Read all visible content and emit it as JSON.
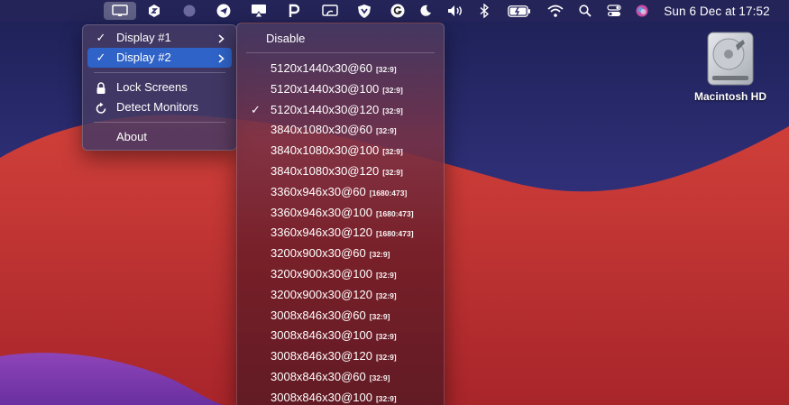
{
  "menubar": {
    "icons": [
      "display-icon",
      "hexagon-app-icon",
      "circle-app-icon",
      "telegram-icon",
      "airplay-icon",
      "parking-icon",
      "screen-mirror-icon",
      "shield-icon",
      "grammarly-icon",
      "moon-icon",
      "volume-icon",
      "bluetooth-icon",
      "battery-icon",
      "wifi-icon",
      "search-icon",
      "control-center-icon",
      "siri-icon"
    ],
    "clock": "Sun 6 Dec at  17:52"
  },
  "desktop": {
    "drive_label": "Macintosh HD"
  },
  "main_menu": {
    "items": [
      {
        "label": "Display #1",
        "checked": true,
        "submenu": true
      },
      {
        "label": "Display #2",
        "checked": true,
        "submenu": true,
        "highlighted": true
      },
      {
        "label": "Lock Screens",
        "icon": "lock-icon"
      },
      {
        "label": "Detect Monitors",
        "icon": "refresh-icon"
      },
      {
        "label": "About"
      }
    ],
    "check_glyph": "✓",
    "chevron_glyph": ">"
  },
  "sub_menu": {
    "disable_label": "Disable",
    "resolutions": [
      {
        "res": "5120x1440x30@60",
        "ratio": "[32:9]",
        "checked": false
      },
      {
        "res": "5120x1440x30@100",
        "ratio": "[32:9]",
        "checked": false
      },
      {
        "res": "5120x1440x30@120",
        "ratio": "[32:9]",
        "checked": true
      },
      {
        "res": "3840x1080x30@60",
        "ratio": "[32:9]",
        "checked": false
      },
      {
        "res": "3840x1080x30@100",
        "ratio": "[32:9]",
        "checked": false
      },
      {
        "res": "3840x1080x30@120",
        "ratio": "[32:9]",
        "checked": false
      },
      {
        "res": "3360x946x30@60",
        "ratio": "[1680:473]",
        "checked": false
      },
      {
        "res": "3360x946x30@100",
        "ratio": "[1680:473]",
        "checked": false
      },
      {
        "res": "3360x946x30@120",
        "ratio": "[1680:473]",
        "checked": false
      },
      {
        "res": "3200x900x30@60",
        "ratio": "[32:9]",
        "checked": false
      },
      {
        "res": "3200x900x30@100",
        "ratio": "[32:9]",
        "checked": false
      },
      {
        "res": "3200x900x30@120",
        "ratio": "[32:9]",
        "checked": false
      },
      {
        "res": "3008x846x30@60",
        "ratio": "[32:9]",
        "checked": false
      },
      {
        "res": "3008x846x30@100",
        "ratio": "[32:9]",
        "checked": false
      },
      {
        "res": "3008x846x30@120",
        "ratio": "[32:9]",
        "checked": false
      },
      {
        "res": "3008x846x30@60",
        "ratio": "[32:9]",
        "checked": false
      },
      {
        "res": "3008x846x30@100",
        "ratio": "[32:9]",
        "checked": false
      }
    ]
  },
  "colors": {
    "highlight": "#2f63c7",
    "wallpaper_red": "#c0342f",
    "wallpaper_purple": "#8a3fb0"
  }
}
